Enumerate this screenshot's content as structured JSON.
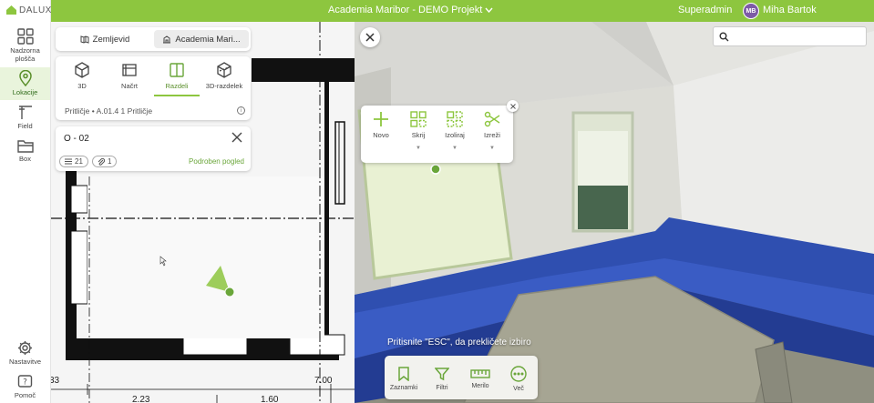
{
  "app": {
    "logo_text": "DALUX",
    "project_title": "Academia Maribor - DEMO Projekt",
    "user_role": "Superadmin",
    "user_initials": "MB",
    "user_name": "Miha Bartok",
    "brand_color": "#8dc63f"
  },
  "leftnav": {
    "items": [
      {
        "label_line1": "Nadzorna",
        "label_line2": "plošča",
        "icon": "dashboard-icon"
      },
      {
        "label_line1": "Lokacije",
        "label_line2": "",
        "icon": "location-pin-icon",
        "active": true
      },
      {
        "label_line1": "Field",
        "label_line2": "",
        "icon": "field-icon"
      },
      {
        "label_line1": "Box",
        "label_line2": "",
        "icon": "folder-icon"
      }
    ],
    "bottom_items": [
      {
        "label": "Nastavitve",
        "icon": "gear-icon"
      },
      {
        "label": "Pomoč",
        "icon": "help-icon"
      }
    ]
  },
  "location_panel": {
    "tabs": [
      {
        "label": "Zemljevid",
        "icon": "map-icon"
      },
      {
        "label": "Academia Mari...",
        "icon": "building-icon",
        "selected": true
      }
    ],
    "view_modes": [
      {
        "label": "3D",
        "icon": "cube-icon"
      },
      {
        "label": "Načrt",
        "icon": "plan-icon"
      },
      {
        "label": "Razdeli",
        "icon": "split-view-icon",
        "active": true
      },
      {
        "label": "3D-razdelek",
        "icon": "section-cube-icon"
      }
    ],
    "floor_path": "Pritličje • A.01.4 1 Pritličje",
    "room": {
      "name": "O - 02",
      "list_count": "21",
      "link_count": "1",
      "detail_link": "Podroben pogled"
    }
  },
  "plan": {
    "dimensions": [
      "33",
      "7.00",
      "2.23",
      "1.60"
    ]
  },
  "view3d": {
    "search_placeholder": "",
    "tools": [
      {
        "label": "Novo",
        "icon": "plus-icon"
      },
      {
        "label": "Skrij",
        "icon": "hide-grid-icon"
      },
      {
        "label": "Izoliraj",
        "icon": "isolate-grid-icon"
      },
      {
        "label": "Izreži",
        "icon": "scissors-icon"
      }
    ],
    "esc_hint": "Pritisnite \"ESC\", da prekličete izbiro",
    "bottom_tools": [
      {
        "label": "Zaznamki",
        "icon": "bookmark-icon"
      },
      {
        "label": "Filtri",
        "icon": "filter-icon"
      },
      {
        "label": "Merilo",
        "icon": "ruler-icon"
      },
      {
        "label": "Več",
        "icon": "more-icon"
      }
    ]
  }
}
